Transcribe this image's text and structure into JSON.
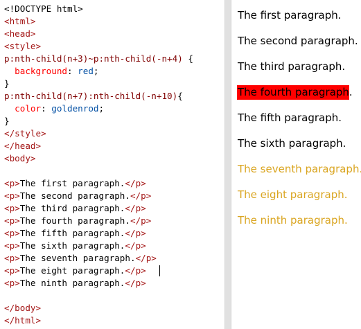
{
  "colors": {
    "tag": "#a31515",
    "selector": "#800000",
    "property": "#ff0000",
    "value": "#0451a5",
    "text": "#000000",
    "highlight_bg": "#ff0000",
    "goldenrod": "#daa520"
  },
  "editor": {
    "lines": [
      [
        {
          "t": "<!DOCTYPE html>",
          "c": "text"
        }
      ],
      [
        {
          "t": "<html>",
          "c": "tag"
        }
      ],
      [
        {
          "t": "<head>",
          "c": "tag"
        }
      ],
      [
        {
          "t": "<style>",
          "c": "tag"
        }
      ],
      [
        {
          "t": "p:nth-child(n+3)~p:nth-child(-n+4)",
          "c": "selector"
        },
        {
          "t": " {",
          "c": "text"
        }
      ],
      [
        {
          "t": "  ",
          "c": "text"
        },
        {
          "t": "background",
          "c": "property"
        },
        {
          "t": ": ",
          "c": "text"
        },
        {
          "t": "red",
          "c": "value"
        },
        {
          "t": ";",
          "c": "text"
        }
      ],
      [
        {
          "t": "}",
          "c": "text"
        }
      ],
      [
        {
          "t": "p:nth-child(n+7):nth-child(-n+10)",
          "c": "selector"
        },
        {
          "t": "{",
          "c": "text"
        }
      ],
      [
        {
          "t": "  ",
          "c": "text"
        },
        {
          "t": "color",
          "c": "property"
        },
        {
          "t": ": ",
          "c": "text"
        },
        {
          "t": "goldenrod",
          "c": "value"
        },
        {
          "t": ";",
          "c": "text"
        }
      ],
      [
        {
          "t": "}",
          "c": "text"
        }
      ],
      [
        {
          "t": "</style>",
          "c": "tag"
        }
      ],
      [
        {
          "t": "</head>",
          "c": "tag"
        }
      ],
      [
        {
          "t": "<body>",
          "c": "tag"
        }
      ],
      [],
      [
        {
          "t": "<p>",
          "c": "tag"
        },
        {
          "t": "The first paragraph.",
          "c": "text"
        },
        {
          "t": "</p>",
          "c": "tag"
        }
      ],
      [
        {
          "t": "<p>",
          "c": "tag"
        },
        {
          "t": "The second paragraph.",
          "c": "text"
        },
        {
          "t": "</p>",
          "c": "tag"
        }
      ],
      [
        {
          "t": "<p>",
          "c": "tag"
        },
        {
          "t": "The third paragraph.",
          "c": "text"
        },
        {
          "t": "</p>",
          "c": "tag"
        }
      ],
      [
        {
          "t": "<p>",
          "c": "tag"
        },
        {
          "t": "The fourth paragraph.",
          "c": "text"
        },
        {
          "t": "</p>",
          "c": "tag"
        }
      ],
      [
        {
          "t": "<p>",
          "c": "tag"
        },
        {
          "t": "The fifth paragraph.",
          "c": "text"
        },
        {
          "t": "</p>",
          "c": "tag"
        }
      ],
      [
        {
          "t": "<p>",
          "c": "tag"
        },
        {
          "t": "The sixth paragraph.",
          "c": "text"
        },
        {
          "t": "</p>",
          "c": "tag"
        }
      ],
      [
        {
          "t": "<p>",
          "c": "tag"
        },
        {
          "t": "The seventh paragraph.",
          "c": "text"
        },
        {
          "t": "</p>",
          "c": "tag"
        }
      ],
      [
        {
          "t": "<p>",
          "c": "tag"
        },
        {
          "t": "The eight paragraph.",
          "c": "text"
        },
        {
          "t": "</p>",
          "c": "tag"
        }
      ],
      [
        {
          "t": "<p>",
          "c": "tag"
        },
        {
          "t": "The ninth paragraph.",
          "c": "text"
        },
        {
          "t": "</p>",
          "c": "tag"
        }
      ],
      [],
      [
        {
          "t": "</body>",
          "c": "tag"
        }
      ],
      [
        {
          "t": "</html>",
          "c": "tag"
        }
      ]
    ]
  },
  "preview": {
    "paragraphs": [
      {
        "text": "The first paragraph.",
        "style": "normal"
      },
      {
        "text": "The second paragraph.",
        "style": "normal"
      },
      {
        "text": "The third paragraph.",
        "style": "normal"
      },
      {
        "text": "The fourth paragraph.",
        "style": "highlight"
      },
      {
        "text": "The fifth paragraph.",
        "style": "normal"
      },
      {
        "text": "The sixth paragraph.",
        "style": "normal"
      },
      {
        "text": "The seventh paragraph.",
        "style": "goldenrod"
      },
      {
        "text": "The eight paragraph.",
        "style": "goldenrod"
      },
      {
        "text": "The ninth paragraph.",
        "style": "goldenrod"
      }
    ]
  }
}
